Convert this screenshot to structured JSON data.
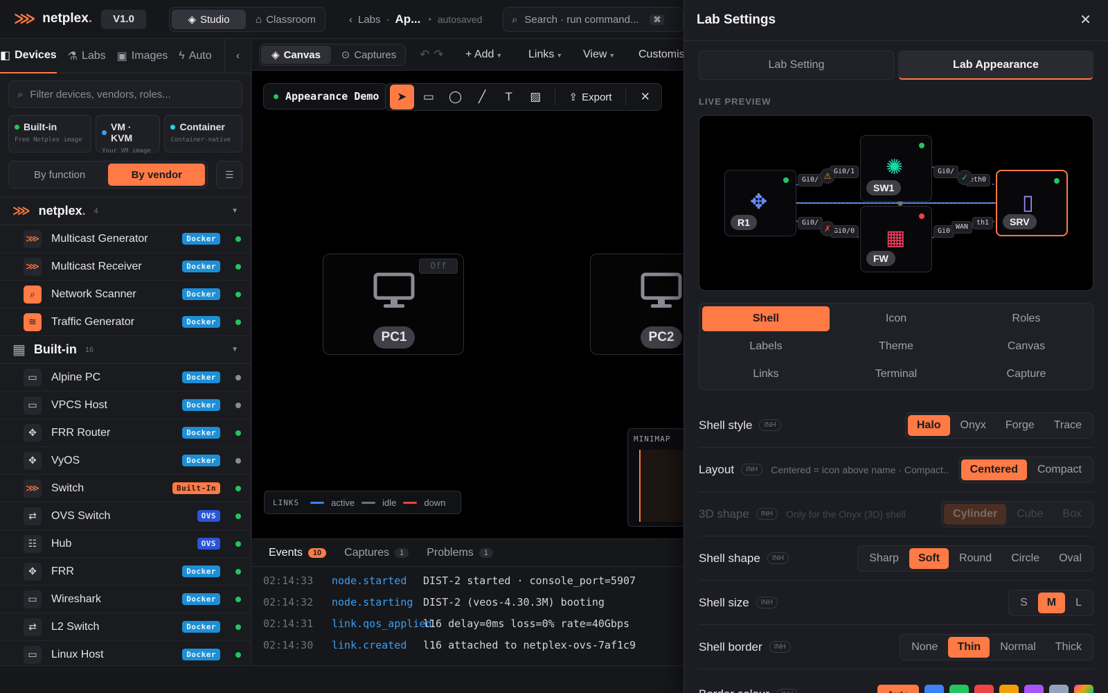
{
  "app": {
    "logo_text": "netplex",
    "logo_dot": ".",
    "version": "V1.0",
    "modes": [
      "Studio",
      "Classroom"
    ],
    "breadcrumb": {
      "parent": "Labs",
      "current": "Ap...",
      "status": "autosaved"
    },
    "command_search": {
      "placeholder": "Search · run command...",
      "shortcut": "⌘"
    }
  },
  "sidebar": {
    "tabs": [
      "Devices",
      "Labs",
      "Images",
      "Auto"
    ],
    "filter_placeholder": "Filter devices, vendors, roles...",
    "sources": [
      {
        "title": "Built-in",
        "subtitle": "Free Netplex image",
        "color": "#22c55e"
      },
      {
        "title": "VM · KVM",
        "subtitle": "Your VM image",
        "color": "#3b9ef0"
      },
      {
        "title": "Container",
        "subtitle": "Container-native",
        "color": "#22d3ee"
      }
    ],
    "grouping": {
      "options": [
        "By function",
        "By vendor"
      ],
      "selected": "By vendor"
    },
    "groups": [
      {
        "name": "netplex",
        "dot": ".",
        "count": "4"
      },
      {
        "name": "Built-in",
        "count": "16"
      }
    ],
    "devices_netplex": [
      {
        "name": "Multicast Generator",
        "badge": "Docker",
        "running": true
      },
      {
        "name": "Multicast Receiver",
        "badge": "Docker",
        "running": true
      },
      {
        "name": "Network Scanner",
        "badge": "Docker",
        "running": true
      },
      {
        "name": "Traffic Generator",
        "badge": "Docker",
        "running": true
      }
    ],
    "devices_builtin": [
      {
        "name": "Alpine PC",
        "badge": "Docker",
        "running": false
      },
      {
        "name": "VPCS Host",
        "badge": "Docker",
        "running": false
      },
      {
        "name": "FRR Router",
        "badge": "Docker",
        "running": true
      },
      {
        "name": "VyOS",
        "badge": "Docker",
        "running": false
      },
      {
        "name": "Switch",
        "badge": "Built-In",
        "running": true
      },
      {
        "name": "OVS Switch",
        "badge": "OVS",
        "running": true
      },
      {
        "name": "Hub",
        "badge": "OVS",
        "running": true
      },
      {
        "name": "FRR",
        "badge": "Docker",
        "running": true
      },
      {
        "name": "Wireshark",
        "badge": "Docker",
        "running": true
      },
      {
        "name": "L2 Switch",
        "badge": "Docker",
        "running": true
      },
      {
        "name": "Linux Host",
        "badge": "Docker",
        "running": true
      }
    ]
  },
  "canvas": {
    "tabs": [
      "Canvas",
      "Captures"
    ],
    "menus": [
      "+ Add",
      "Links",
      "View",
      "Customis"
    ],
    "doc_name": "Appearance Demo",
    "export_label": "Export",
    "nodes": [
      {
        "name": "PC1",
        "state": "Off"
      },
      {
        "name": "PC2"
      }
    ],
    "minimap_label": "MINIMAP",
    "legend": {
      "title": "LINKS",
      "items": [
        {
          "label": "active",
          "color": "#3b82f6"
        },
        {
          "label": "idle",
          "color": "#71717a"
        },
        {
          "label": "down",
          "color": "#ef4444"
        }
      ]
    }
  },
  "events": {
    "tabs": [
      {
        "label": "Events",
        "count": "10"
      },
      {
        "label": "Captures",
        "count": "1"
      },
      {
        "label": "Problems",
        "count": "1"
      }
    ],
    "rows": [
      {
        "time": "02:14:33",
        "kind": "node.started",
        "msg": "DIST-2 started · console_port=5907"
      },
      {
        "time": "02:14:32",
        "kind": "node.starting",
        "msg": "DIST-2 (veos-4.30.3M) booting"
      },
      {
        "time": "02:14:31",
        "kind": "link.qos_applied",
        "msg": "l16 delay=0ms loss=0% rate=40Gbps"
      },
      {
        "time": "02:14:30",
        "kind": "link.created",
        "msg": "l16 attached to netplex-ovs-7af1c9"
      }
    ]
  },
  "panel": {
    "title": "Lab Settings",
    "tabs": [
      "Lab Setting",
      "Lab Appearance"
    ],
    "active_tab": "Lab Appearance",
    "live_preview_label": "LIVE PREVIEW",
    "preview": {
      "nodes": [
        "R1",
        "SW1",
        "FW",
        "SRV"
      ],
      "ports": [
        "Gi0/",
        "Gi0/1",
        "Gi0/",
        "eth0",
        "Gi0/",
        "Gi0/0",
        "Gi0",
        "WAN",
        "th1"
      ]
    },
    "categories": [
      "Shell",
      "Icon",
      "Roles",
      "Labels",
      "Theme",
      "Canvas",
      "Links",
      "Terminal",
      "Capture"
    ],
    "active_category": "Shell",
    "inherit_badge": "INH",
    "settings": [
      {
        "label": "Shell style",
        "hint": "",
        "options": [
          "Halo",
          "Onyx",
          "Forge",
          "Trace"
        ],
        "selected": "Halo"
      },
      {
        "label": "Layout",
        "hint": "Centered = icon above name · Compact...",
        "options": [
          "Centered",
          "Compact"
        ],
        "selected": "Centered"
      },
      {
        "label": "3D shape",
        "hint": "Only for the Onyx (3D) shell",
        "options": [
          "Cylinder",
          "Cube",
          "Box"
        ],
        "selected": "Cylinder",
        "disabled": true
      },
      {
        "label": "Shell shape",
        "hint": "",
        "options": [
          "Sharp",
          "Soft",
          "Round",
          "Circle",
          "Oval"
        ],
        "selected": "Soft"
      },
      {
        "label": "Shell size",
        "hint": "",
        "options": [
          "S",
          "M",
          "L"
        ],
        "selected": "M"
      },
      {
        "label": "Shell border",
        "hint": "",
        "options": [
          "None",
          "Thin",
          "Normal",
          "Thick"
        ],
        "selected": "Thin"
      }
    ],
    "border_colour": {
      "label": "Border colour",
      "auto_label": "Auto",
      "swatches": [
        "#3b82f6",
        "#22c55e",
        "#ef4444",
        "#f59e0b",
        "#a855f7",
        "#94a3b8",
        "#ff3ea5"
      ]
    }
  }
}
